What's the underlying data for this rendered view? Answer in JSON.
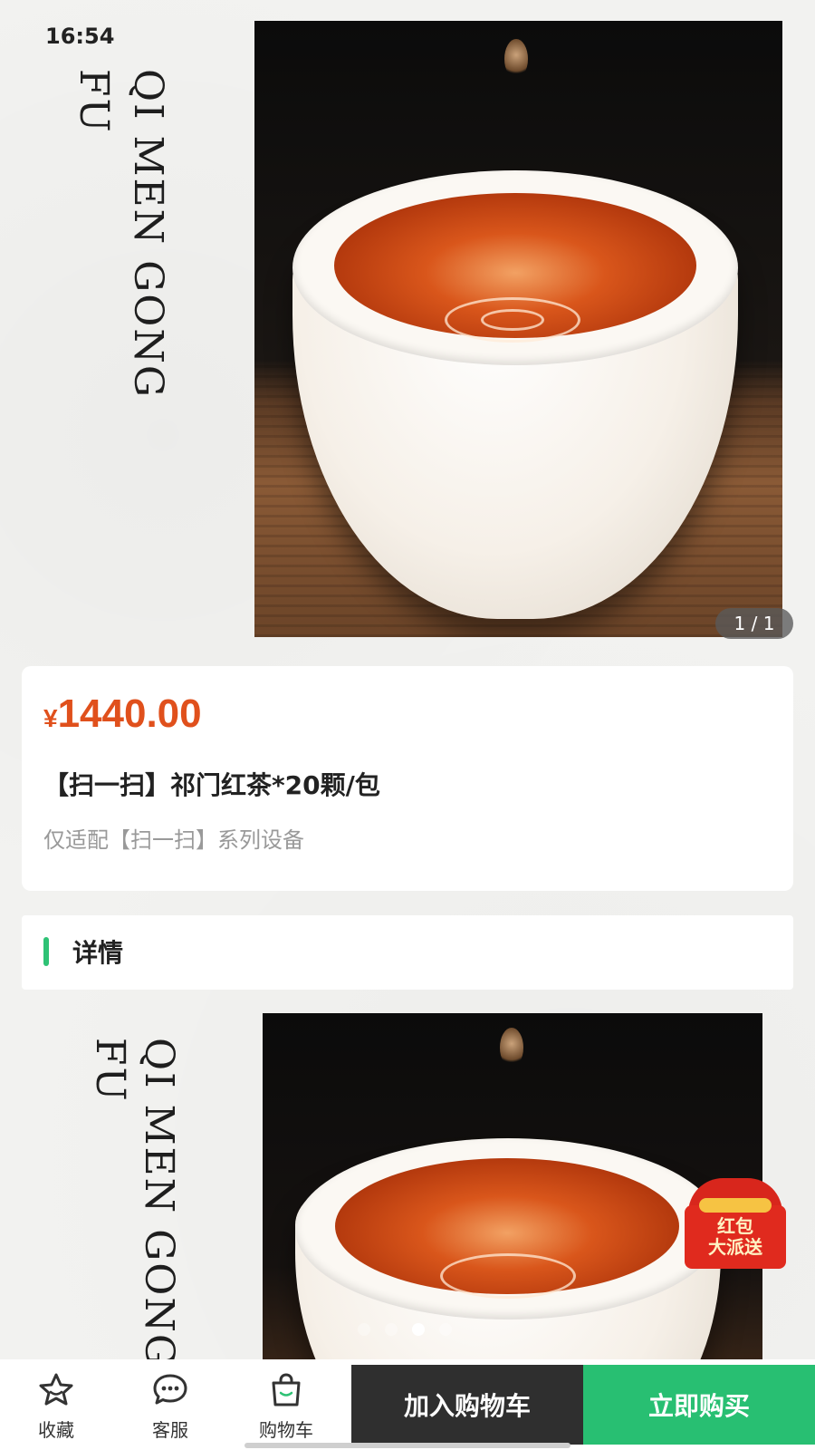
{
  "status_bar": {
    "time": "16:54"
  },
  "banner": {
    "vertical_text_line1": "QI MEN GONG",
    "vertical_text_line2": "FU",
    "counter": "1 / 1"
  },
  "product": {
    "currency": "¥",
    "price": "1440.00",
    "title": "【扫一扫】祁门红茶*20颗/包",
    "subtitle": "仅适配【扫一扫】系列设备",
    "price_color": "#e0501c"
  },
  "detail": {
    "label": "详情",
    "accent_color": "#2ec275",
    "vertical_text_line1": "QI MEN GONG",
    "vertical_text_line2": "FU",
    "carousel_dots": 4,
    "carousel_active": 3
  },
  "promo": {
    "line1": "红包",
    "line2": "大派送",
    "icon": "red-envelope-icon"
  },
  "bottom_bar": {
    "tabs": [
      {
        "label": "收藏",
        "icon": "star-icon"
      },
      {
        "label": "客服",
        "icon": "chat-icon"
      },
      {
        "label": "购物车",
        "icon": "shopping-bag-icon"
      }
    ],
    "add_to_cart_label": "加入购物车",
    "buy_now_label": "立即购买",
    "buy_color": "#28bf72",
    "cart_color": "#2f2f2f"
  }
}
